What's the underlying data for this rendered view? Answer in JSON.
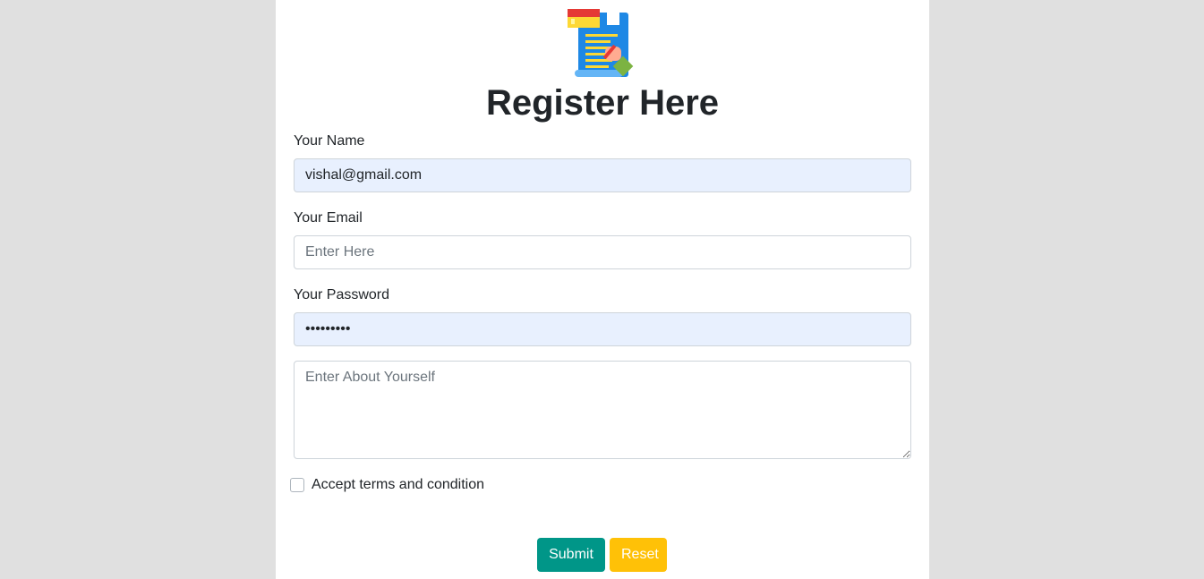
{
  "form": {
    "title": "Register Here",
    "name_label": "Your Name",
    "name_value": "vishal@gmail.com",
    "email_label": "Your Email",
    "email_placeholder": "Enter Here",
    "password_label": "Your Password",
    "password_value": "•••••••••",
    "about_placeholder": "Enter About Yourself",
    "terms_label": "Accept terms and condition",
    "terms_checked": false,
    "submit_label": "Submit",
    "reset_label": "Reset"
  },
  "icons": {
    "logo": "registration-document-icon"
  },
  "colors": {
    "background": "#e0e0e0",
    "card": "#ffffff",
    "autofill": "#e8f0fe",
    "submit": "#009688",
    "reset": "#ffc107"
  }
}
